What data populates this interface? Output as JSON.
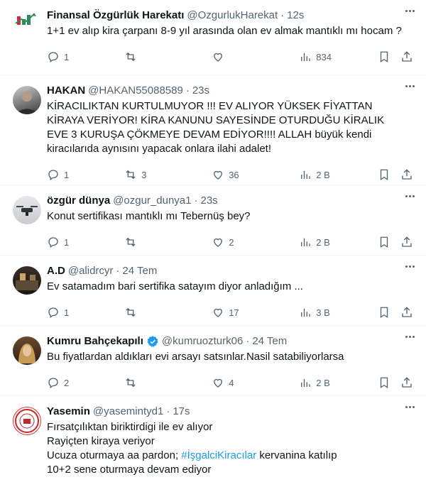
{
  "tweets": [
    {
      "name": "Finansal Özgürlük Harekatı",
      "handle": "@OzgurlukHarekat",
      "time": "12s",
      "verified": false,
      "avatar": "logo",
      "avatar_text": "Finansal Özgürlük Harekatı",
      "text": "1+1 ev alıp kira çarpanı 8-9 yıl arasında olan ev almak mantıklı mı hocam ?",
      "replies": "1",
      "retweets": "",
      "likes": "",
      "views": "834"
    },
    {
      "name": "HAKAN",
      "handle": "@HAKAN55088589",
      "time": "23s",
      "verified": false,
      "avatar": "photo",
      "text": "KİRACILIKTAN KURTULMUYOR !!! EV ALIYOR YÜKSEK FİYATTAN KİRAYA VERİYOR!  KİRA KANUNU SAYESİNDE OTURDUĞU KİRALIK EVE 3 KURUŞA ÇÖKMEYE DEVAM EDİYOR!!!! ALLAH büyük kendi kiracılarıda aynısını yapacak onlara ilahi adalet!",
      "replies": "1",
      "retweets": "3",
      "likes": "36",
      "views": "2 B"
    },
    {
      "name": "özgür dünya",
      "handle": "@ozgur_dunya1",
      "time": "23s",
      "verified": false,
      "avatar": "photo",
      "text": "Konut sertifikası mantıklı mı Tebernüş bey?",
      "replies": "1",
      "retweets": "",
      "likes": "2",
      "views": "2 B"
    },
    {
      "name": "A.D",
      "handle": "@alidrcyr",
      "time": "24 Tem",
      "verified": false,
      "avatar": "photo",
      "text": "Ev satamadım bari sertifika satayım diyor anladığım ...",
      "replies": "1",
      "retweets": "",
      "likes": "17",
      "views": "3 B"
    },
    {
      "name": "Kumru Bahçekapılı",
      "handle": "@kumruozturk06",
      "time": "24 Tem",
      "verified": true,
      "avatar": "photo",
      "text": "Bu fiyatlardan aldıkları evi arsayı satsınlar.Nasil satabiliyorlarsa",
      "replies": "2",
      "retweets": "",
      "likes": "4",
      "views": "2 B"
    },
    {
      "name": "Yasemin",
      "handle": "@yasemintyd1",
      "time": "17s",
      "verified": false,
      "avatar": "seal",
      "text_lines": [
        "Fırsatçılıktan biriktirdigi ile ev alıyor",
        "Rayiçten kiraya veriyor"
      ],
      "text3_before": "Ucuza oturmaya aa pardon; ",
      "hashtag": "#İşgalciKiracılar",
      "text3_after": " kervanina katılıp",
      "text4": "10+2 sene oturmaya devam ediyor"
    }
  ],
  "colors": {
    "accent": "#1d9bf0",
    "secondary": "#536471",
    "divider": "#eff3f4"
  }
}
